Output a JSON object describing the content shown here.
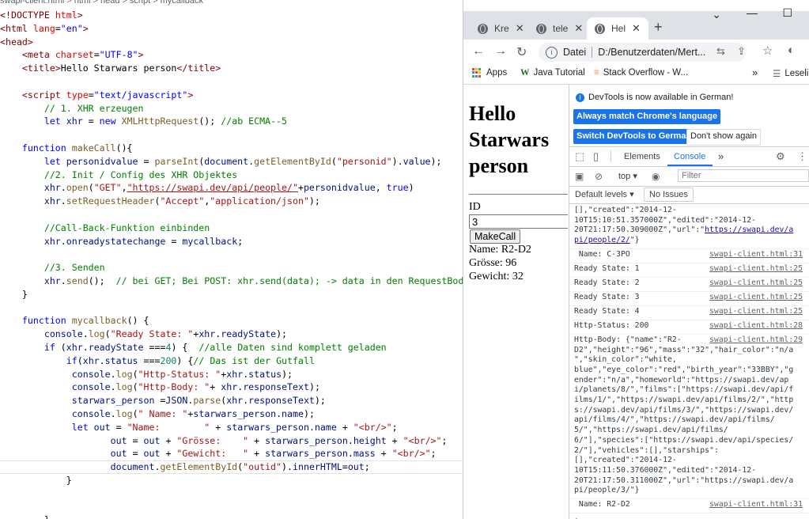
{
  "editor": {
    "breadcrumb": [
      "swapi-client.html",
      ">",
      "html",
      ">",
      "head",
      ">",
      "script",
      ">",
      "mycallback"
    ],
    "lines": [
      [
        [
          "t-tag",
          "<!DOCTYPE "
        ],
        [
          "t-attr",
          "html"
        ],
        [
          "t-tag",
          ">"
        ]
      ],
      [
        [
          "t-tag",
          "<html "
        ],
        [
          "t-attr",
          "lang"
        ],
        [
          "t-txt",
          "="
        ],
        [
          "t-kw",
          "\"en\""
        ],
        [
          "t-tag",
          ">"
        ]
      ],
      [
        [
          "t-tag",
          "<head>"
        ]
      ],
      [
        [
          "t-txt",
          "    "
        ],
        [
          "t-tag",
          "<meta "
        ],
        [
          "t-attr",
          "charset"
        ],
        [
          "t-txt",
          "="
        ],
        [
          "t-kw",
          "\"UTF-8\""
        ],
        [
          "t-tag",
          ">"
        ]
      ],
      [
        [
          "t-txt",
          "    "
        ],
        [
          "t-tag",
          "<title>"
        ],
        [
          "t-txt",
          "Hello Starwars person"
        ],
        [
          "t-tag",
          "</title>"
        ]
      ],
      [
        [
          "t-txt",
          ""
        ]
      ],
      [
        [
          "t-txt",
          "    "
        ],
        [
          "t-tag",
          "<script "
        ],
        [
          "t-attr",
          "type"
        ],
        [
          "t-txt",
          "="
        ],
        [
          "t-kw",
          "\"text/javascript\""
        ],
        [
          "t-tag",
          ">"
        ]
      ],
      [
        [
          "t-txt",
          "        "
        ],
        [
          "t-cm",
          "// 1. XHR erzeugen"
        ]
      ],
      [
        [
          "t-txt",
          "        "
        ],
        [
          "t-kw",
          "let "
        ],
        [
          "t-var",
          "xhr"
        ],
        [
          "t-txt",
          " = "
        ],
        [
          "t-kw",
          "new "
        ],
        [
          "t-fn",
          "XMLHttpRequest"
        ],
        [
          "t-txt",
          "(); "
        ],
        [
          "t-cm",
          "//ab ECMA--5"
        ]
      ],
      [
        [
          "t-txt",
          ""
        ]
      ],
      [
        [
          "t-txt",
          "    "
        ],
        [
          "t-kw",
          "function "
        ],
        [
          "t-fn",
          "makeCall"
        ],
        [
          "t-txt",
          "(){"
        ]
      ],
      [
        [
          "t-txt",
          "        "
        ],
        [
          "t-kw",
          "let "
        ],
        [
          "t-var",
          "personidvalue"
        ],
        [
          "t-txt",
          " = "
        ],
        [
          "t-fn",
          "parseInt"
        ],
        [
          "t-txt",
          "("
        ],
        [
          "t-var",
          "document"
        ],
        [
          "t-txt",
          "."
        ],
        [
          "t-fn",
          "getElementById"
        ],
        [
          "t-txt",
          "("
        ],
        [
          "t-str",
          "\"personid\""
        ],
        [
          "t-txt",
          ")."
        ],
        [
          "t-var",
          "value"
        ],
        [
          "t-txt",
          ");"
        ]
      ],
      [
        [
          "t-txt",
          "        "
        ],
        [
          "t-cm",
          "//2. Init / Config des XHR Objektes"
        ]
      ],
      [
        [
          "t-txt",
          "        "
        ],
        [
          "t-var",
          "xhr"
        ],
        [
          "t-txt",
          "."
        ],
        [
          "t-fn",
          "open"
        ],
        [
          "t-txt",
          "("
        ],
        [
          "t-str",
          "\"GET\""
        ],
        [
          "t-txt",
          ","
        ],
        [
          "t-url",
          "\"https://swapi.dev/api/people/\""
        ],
        [
          "t-txt",
          "+"
        ],
        [
          "t-var",
          "personidvalue"
        ],
        [
          "t-txt",
          ", "
        ],
        [
          "t-kw",
          "true"
        ],
        [
          "t-txt",
          ")"
        ]
      ],
      [
        [
          "t-txt",
          "        "
        ],
        [
          "t-var",
          "xhr"
        ],
        [
          "t-txt",
          "."
        ],
        [
          "t-fn",
          "setRequestHeader"
        ],
        [
          "t-txt",
          "("
        ],
        [
          "t-str",
          "\"Accept\""
        ],
        [
          "t-txt",
          ","
        ],
        [
          "t-str",
          "\"application/json\""
        ],
        [
          "t-txt",
          ");"
        ]
      ],
      [
        [
          "t-txt",
          ""
        ]
      ],
      [
        [
          "t-txt",
          "        "
        ],
        [
          "t-cm",
          "//Call-Back-Funktion einbinden"
        ]
      ],
      [
        [
          "t-txt",
          "        "
        ],
        [
          "t-var",
          "xhr"
        ],
        [
          "t-txt",
          "."
        ],
        [
          "t-var",
          "onreadystatechange"
        ],
        [
          "t-txt",
          " = "
        ],
        [
          "t-var",
          "mycallback"
        ],
        [
          "t-txt",
          ";"
        ]
      ],
      [
        [
          "t-txt",
          ""
        ]
      ],
      [
        [
          "t-txt",
          "        "
        ],
        [
          "t-cm",
          "//3. Senden"
        ]
      ],
      [
        [
          "t-txt",
          "        "
        ],
        [
          "t-var",
          "xhr"
        ],
        [
          "t-txt",
          "."
        ],
        [
          "t-fn",
          "send"
        ],
        [
          "t-txt",
          "();  "
        ],
        [
          "t-cm",
          "// bei GET; Bei POST: xhr.send(data); -> data in den RequestBody"
        ]
      ],
      [
        [
          "t-txt",
          "    }"
        ]
      ],
      [
        [
          "t-txt",
          ""
        ]
      ],
      [
        [
          "t-txt",
          "    "
        ],
        [
          "t-kw",
          "function "
        ],
        [
          "t-fn",
          "mycallback"
        ],
        [
          "t-txt",
          "() {"
        ]
      ],
      [
        [
          "t-txt",
          "        "
        ],
        [
          "t-var",
          "console"
        ],
        [
          "t-txt",
          "."
        ],
        [
          "t-fn",
          "log"
        ],
        [
          "t-txt",
          "("
        ],
        [
          "t-str",
          "\"Ready State: \""
        ],
        [
          "t-txt",
          "+"
        ],
        [
          "t-var",
          "xhr"
        ],
        [
          "t-txt",
          "."
        ],
        [
          "t-var",
          "readyState"
        ],
        [
          "t-txt",
          ");"
        ]
      ],
      [
        [
          "t-txt",
          "        "
        ],
        [
          "t-kw",
          "if "
        ],
        [
          "t-txt",
          "("
        ],
        [
          "t-var",
          "xhr"
        ],
        [
          "t-txt",
          "."
        ],
        [
          "t-var",
          "readyState"
        ],
        [
          "t-txt",
          " ==="
        ],
        [
          "t-num",
          "4"
        ],
        [
          "t-txt",
          ") {  "
        ],
        [
          "t-cm",
          "//alle Daten sind komplett geladen"
        ]
      ],
      [
        [
          "t-txt",
          "            "
        ],
        [
          "t-kw",
          "if"
        ],
        [
          "t-txt",
          "("
        ],
        [
          "t-var",
          "xhr"
        ],
        [
          "t-txt",
          "."
        ],
        [
          "t-var",
          "status"
        ],
        [
          "t-txt",
          " ==="
        ],
        [
          "t-num",
          "200"
        ],
        [
          "t-txt",
          ") "
        ],
        [
          "t-txt",
          "{"
        ],
        [
          "t-cm",
          "// Das ist der Gutfall"
        ]
      ],
      [
        [
          "t-txt",
          "             "
        ],
        [
          "t-var",
          "console"
        ],
        [
          "t-txt",
          "."
        ],
        [
          "t-fn",
          "log"
        ],
        [
          "t-txt",
          "("
        ],
        [
          "t-str",
          "\"Http-Status: \""
        ],
        [
          "t-txt",
          "+"
        ],
        [
          "t-var",
          "xhr"
        ],
        [
          "t-txt",
          "."
        ],
        [
          "t-var",
          "status"
        ],
        [
          "t-txt",
          ");"
        ]
      ],
      [
        [
          "t-txt",
          "             "
        ],
        [
          "t-var",
          "console"
        ],
        [
          "t-txt",
          "."
        ],
        [
          "t-fn",
          "log"
        ],
        [
          "t-txt",
          "("
        ],
        [
          "t-str",
          "\"Http-Body: \""
        ],
        [
          "t-txt",
          "+ "
        ],
        [
          "t-var",
          "xhr"
        ],
        [
          "t-txt",
          "."
        ],
        [
          "t-var",
          "responseText"
        ],
        [
          "t-txt",
          ");"
        ]
      ],
      [
        [
          "t-txt",
          "             "
        ],
        [
          "t-var",
          "starwars_person"
        ],
        [
          "t-txt",
          " ="
        ],
        [
          "t-var",
          "JSON"
        ],
        [
          "t-txt",
          "."
        ],
        [
          "t-fn",
          "parse"
        ],
        [
          "t-txt",
          "("
        ],
        [
          "t-var",
          "xhr"
        ],
        [
          "t-txt",
          "."
        ],
        [
          "t-var",
          "responseText"
        ],
        [
          "t-txt",
          ");"
        ]
      ],
      [
        [
          "t-txt",
          "             "
        ],
        [
          "t-var",
          "console"
        ],
        [
          "t-txt",
          "."
        ],
        [
          "t-fn",
          "log"
        ],
        [
          "t-txt",
          "("
        ],
        [
          "t-str",
          "\" Name: \""
        ],
        [
          "t-txt",
          "+"
        ],
        [
          "t-var",
          "starwars_person"
        ],
        [
          "t-txt",
          "."
        ],
        [
          "t-var",
          "name"
        ],
        [
          "t-txt",
          ");"
        ]
      ],
      [
        [
          "t-txt",
          "             "
        ],
        [
          "t-kw",
          "let "
        ],
        [
          "t-var",
          "out"
        ],
        [
          "t-txt",
          " = "
        ],
        [
          "t-str",
          "\"Name:        \""
        ],
        [
          "t-txt",
          " + "
        ],
        [
          "t-var",
          "starwars_person"
        ],
        [
          "t-txt",
          "."
        ],
        [
          "t-var",
          "name"
        ],
        [
          "t-txt",
          " + "
        ],
        [
          "t-str",
          "\"<br/>\""
        ],
        [
          "t-txt",
          ";"
        ]
      ],
      [
        [
          "t-txt",
          "                    "
        ],
        [
          "t-var",
          "out"
        ],
        [
          "t-txt",
          " = "
        ],
        [
          "t-var",
          "out"
        ],
        [
          "t-txt",
          " + "
        ],
        [
          "t-str",
          "\"Grösse:    \""
        ],
        [
          "t-txt",
          " + "
        ],
        [
          "t-var",
          "starwars_person"
        ],
        [
          "t-txt",
          "."
        ],
        [
          "t-var",
          "height"
        ],
        [
          "t-txt",
          " + "
        ],
        [
          "t-str",
          "\"<br/>\""
        ],
        [
          "t-txt",
          ";"
        ]
      ],
      [
        [
          "t-txt",
          "                    "
        ],
        [
          "t-var",
          "out"
        ],
        [
          "t-txt",
          " = "
        ],
        [
          "t-var",
          "out"
        ],
        [
          "t-txt",
          " + "
        ],
        [
          "t-str",
          "\"Gewicht:   \""
        ],
        [
          "t-txt",
          " + "
        ],
        [
          "t-var",
          "starwars_person"
        ],
        [
          "t-txt",
          "."
        ],
        [
          "t-var",
          "mass"
        ],
        [
          "t-txt",
          " + "
        ],
        [
          "t-str",
          "\"<br/>\""
        ],
        [
          "t-txt",
          ";"
        ]
      ],
      [
        [
          "t-txt",
          "                    "
        ],
        [
          "t-var",
          "document"
        ],
        [
          "t-txt",
          "."
        ],
        [
          "t-fn",
          "getElementById"
        ],
        [
          "t-txt",
          "("
        ],
        [
          "t-str",
          "\"outid\""
        ],
        [
          "t-txt",
          ")."
        ],
        [
          "t-var",
          "innerHTML"
        ],
        [
          "t-txt",
          "="
        ],
        [
          "t-var",
          "out"
        ],
        [
          "t-txt",
          ";"
        ]
      ],
      [
        [
          "t-txt",
          "            }"
        ]
      ],
      [
        [
          "t-txt",
          ""
        ]
      ],
      [
        [
          "t-txt",
          ""
        ]
      ],
      [
        [
          "t-txt",
          "        }"
        ]
      ],
      [
        [
          "t-txt",
          "    }"
        ]
      ]
    ]
  },
  "browser": {
    "tabs": [
      {
        "label": "Kre",
        "close": "✕"
      },
      {
        "label": "tele",
        "close": "✕"
      },
      {
        "label": "Hel",
        "close": "✕"
      }
    ],
    "new_tab": "+",
    "window_controls": {
      "chevron": "⌄",
      "minimize": "—",
      "maximize": "☐"
    },
    "nav": {
      "back": "←",
      "forward": "→",
      "reload": "↻"
    },
    "omnibox": {
      "scheme": "Datei",
      "url": "D:/Benutzerdaten/Mert..."
    },
    "omni_icons": {
      "translate": "⇆",
      "share": "⇪",
      "star": "☆",
      "profile": "◐"
    },
    "bookmarks": [
      {
        "label": "Apps"
      },
      {
        "label": "Java Tutorial"
      },
      {
        "label": "Stack Overflow - W..."
      }
    ],
    "bookmarks_more": "»",
    "reading_list": "Leseli",
    "page": {
      "title": "Hello Starwars person",
      "id_label": "ID",
      "id_value": "3",
      "button_label": "MakeCall",
      "output": "Name: R2-D2\nGrösse: 96\nGewicht: 32"
    }
  },
  "devtools": {
    "info_message": "DevTools is now available in German!",
    "btn_match": "Always match Chrome's language",
    "btn_switch": "Switch DevTools to German",
    "btn_dont_show": "Don't show again",
    "tabs": {
      "elements": "Elements",
      "console": "Console",
      "more": "»"
    },
    "context": "top",
    "filter_placeholder": "Filter",
    "default_levels": "Default levels ▾",
    "no_issues": "No Issues",
    "rows": [
      {
        "text": "[],\"created\":\"2014-12-\n10T15:10:51.357000Z\",\"edited\":\"2014-12-\n20T21:17:50.309000Z\",\"url\":\"",
        "link": "https://swapi.dev/a\npi/people/2/",
        "after": "\"}",
        "src": ""
      },
      {
        "text": " Name: C-3PO",
        "src": "swapi-client.html:31"
      },
      {
        "text": "Ready State: 1",
        "src": "swapi-client.html:25"
      },
      {
        "text": "Ready State: 2",
        "src": "swapi-client.html:25"
      },
      {
        "text": "Ready State: 3",
        "src": "swapi-client.html:25"
      },
      {
        "text": "Ready State: 4",
        "src": "swapi-client.html:25"
      },
      {
        "text": "Http-Status: 200",
        "src": "swapi-client.html:28"
      },
      {
        "text": "Http-Body: {\"name\":\"R2-\nD2\",\"height\":\"96\",\"mass\":\"32\",\"hair_color\":\"n/a\n\",\"skin_color\":\"white,\nblue\",\"eye_color\":\"red\",\"birth_year\":\"33BBY\",\"g\nender\":\"n/a\",\"homeworld\":\"https://swapi.dev/ap\ni/planets/8/\",\"films\":[\"https://swapi.dev/api/f\nilms/1/\",\"https://swapi.dev/api/films/2/\",\"http\ns://swapi.dev/api/films/3/\",\"https://swapi.dev/\napi/films/4/\",\"https://swapi.dev/api/films/\n5/\",\"https://swapi.dev/api/films/\n6/\"],\"species\":[\"https://swapi.dev/api/species/\n2/\"],\"vehicles\":[],\"starships\":\n[],\"created\":\"2014-12-\n10T15:11:50.376000Z\",\"edited\":\"2014-12-\n20T21:17:50.311000Z\",\"url\":\"https://swapi.dev/a\npi/people/3/\"}",
        "src": "swapi-client.html:29"
      },
      {
        "text": " Name: R2-D2",
        "src": "swapi-client.html:31"
      }
    ],
    "prompt": "›"
  }
}
